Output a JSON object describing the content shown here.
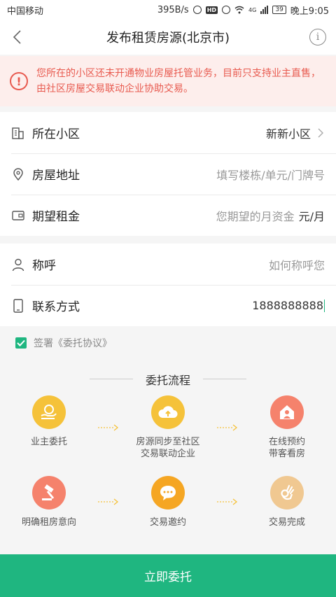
{
  "status_bar": {
    "carrier": "中国移动",
    "speed": "395B/s",
    "network": "4G",
    "battery": "39",
    "time": "晚上9:05"
  },
  "header": {
    "title": "发布租赁房源(北京市)"
  },
  "notice": {
    "text": "您所在的小区还未开通物业房屋托管业务，目前只支持业主直售，由社区房屋交易联动企业协助交易。"
  },
  "form": {
    "community": {
      "label": "所在小区",
      "value": "新新小区"
    },
    "address": {
      "label": "房屋地址",
      "placeholder": "填写楼栋/单元/门牌号"
    },
    "rent": {
      "label": "期望租金",
      "placeholder": "您期望的月资金",
      "unit": "元/月"
    },
    "name": {
      "label": "称呼",
      "placeholder": "如何称呼您"
    },
    "contact": {
      "label": "联系方式",
      "value": "1888888888"
    }
  },
  "agreement": {
    "text": "签署《委托协议》",
    "checked": true
  },
  "flow": {
    "title": "委托流程",
    "steps": [
      {
        "label_l1": "业主委托",
        "label_l2": "",
        "color": "#f5c23a",
        "icon": "hand-coin-icon"
      },
      {
        "label_l1": "房源同步至社区",
        "label_l2": "交易联动企业",
        "color": "#f5c23a",
        "icon": "cloud-upload-icon"
      },
      {
        "label_l1": "在线预约",
        "label_l2": "带客看房",
        "color": "#f5826c",
        "icon": "house-icon"
      },
      {
        "label_l1": "明确租房意向",
        "label_l2": "",
        "color": "#f5826c",
        "icon": "gavel-icon"
      },
      {
        "label_l1": "交易邀约",
        "label_l2": "",
        "color": "#f5a623",
        "icon": "chat-bubble-icon"
      },
      {
        "label_l1": "交易完成",
        "label_l2": "",
        "color": "#f0c891",
        "icon": "ok-hand-icon"
      }
    ]
  },
  "submit": {
    "label": "立即委托"
  },
  "colors": {
    "accent": "#1fb680",
    "warning": "#e85a4f"
  }
}
